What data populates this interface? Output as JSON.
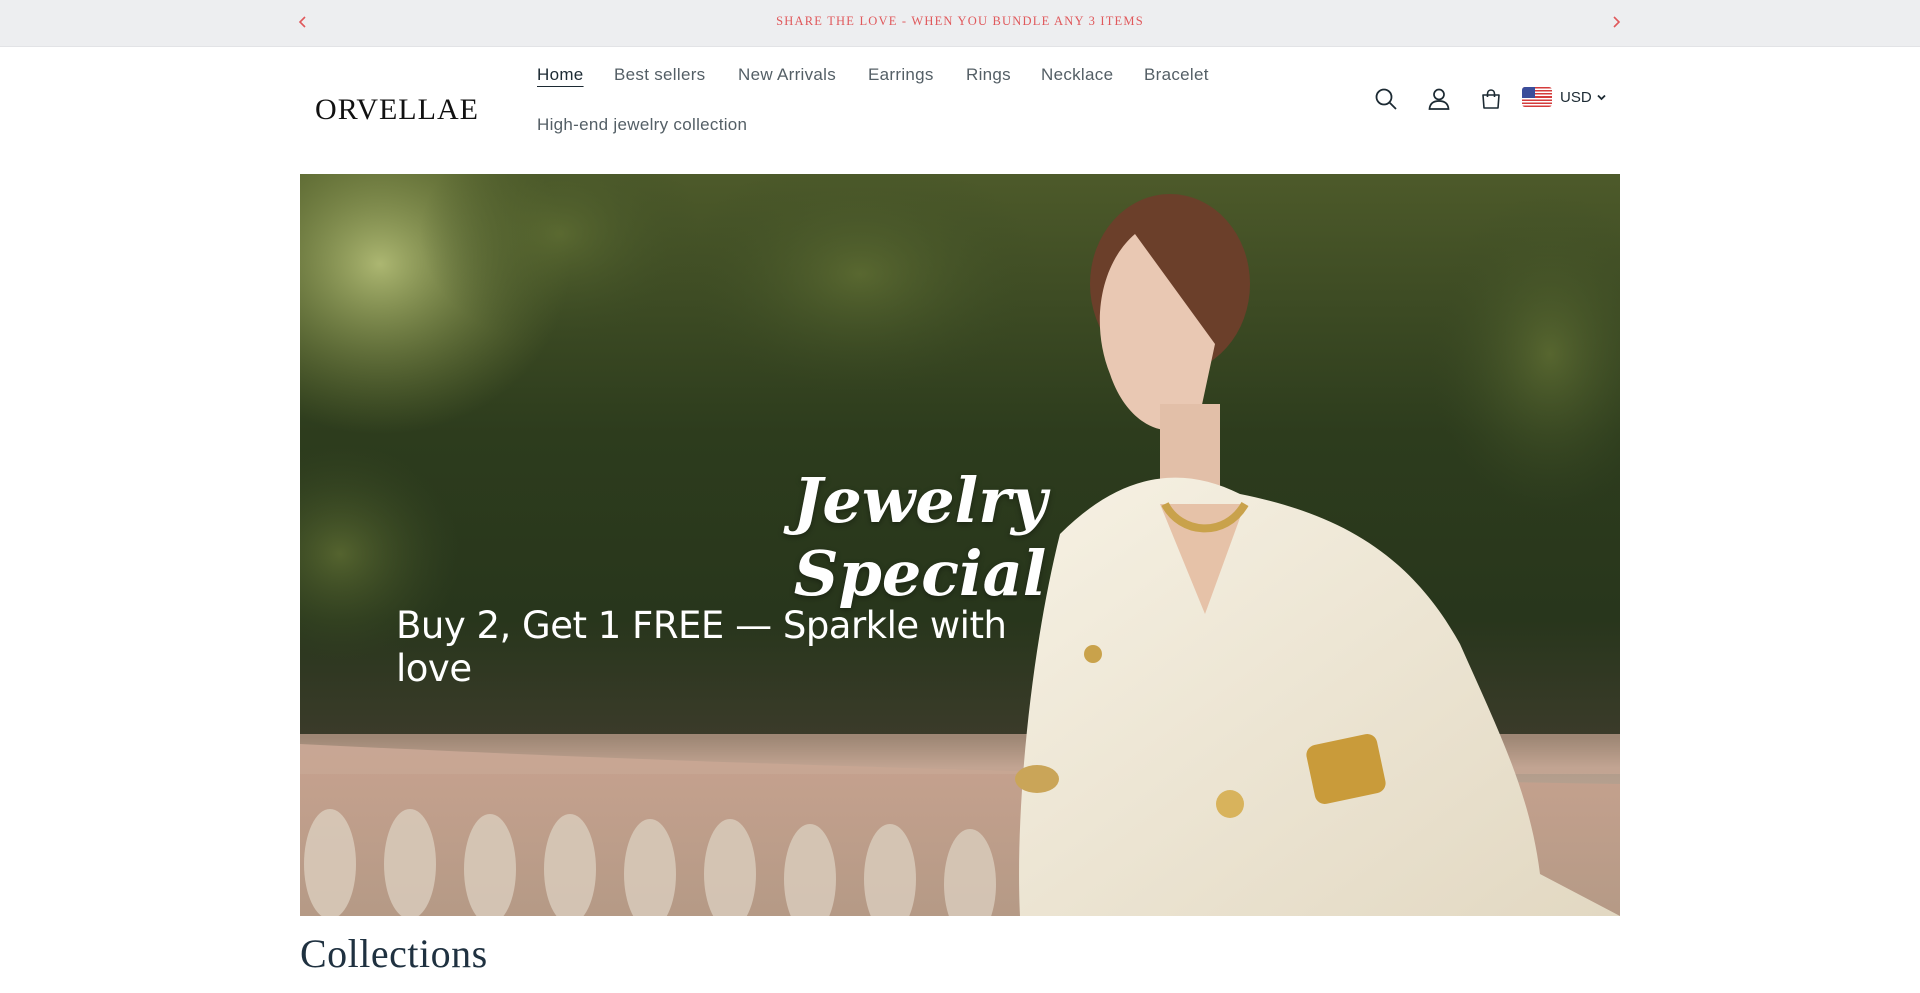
{
  "announcement": {
    "text": "SHARE THE LOVE - WHEN YOU BUNDLE ANY 3 ITEMS"
  },
  "header": {
    "logo": "ORVELLAE",
    "nav": [
      {
        "label": "Home",
        "active": true
      },
      {
        "label": "Best sellers",
        "active": false
      },
      {
        "label": "New Arrivals",
        "active": false
      },
      {
        "label": "Earrings",
        "active": false
      },
      {
        "label": "Rings",
        "active": false
      },
      {
        "label": "Necklace",
        "active": false
      },
      {
        "label": "Bracelet",
        "active": false
      },
      {
        "label": "High-end jewelry collection",
        "active": false
      }
    ],
    "icons": [
      "search-icon",
      "account-icon",
      "cart-icon"
    ],
    "currency": "USD",
    "currency_flag": "us-flag-icon"
  },
  "hero": {
    "title": "Jewelry Special",
    "subtitle": "Buy 2, Get 1 FREE — Sparkle with love"
  },
  "sections": {
    "collections_heading": "Collections"
  },
  "colors": {
    "announcement_bg": "#edeef0",
    "announcement_text": "#e0585b",
    "nav_text": "#545f66",
    "heading_text": "#1f3140"
  }
}
